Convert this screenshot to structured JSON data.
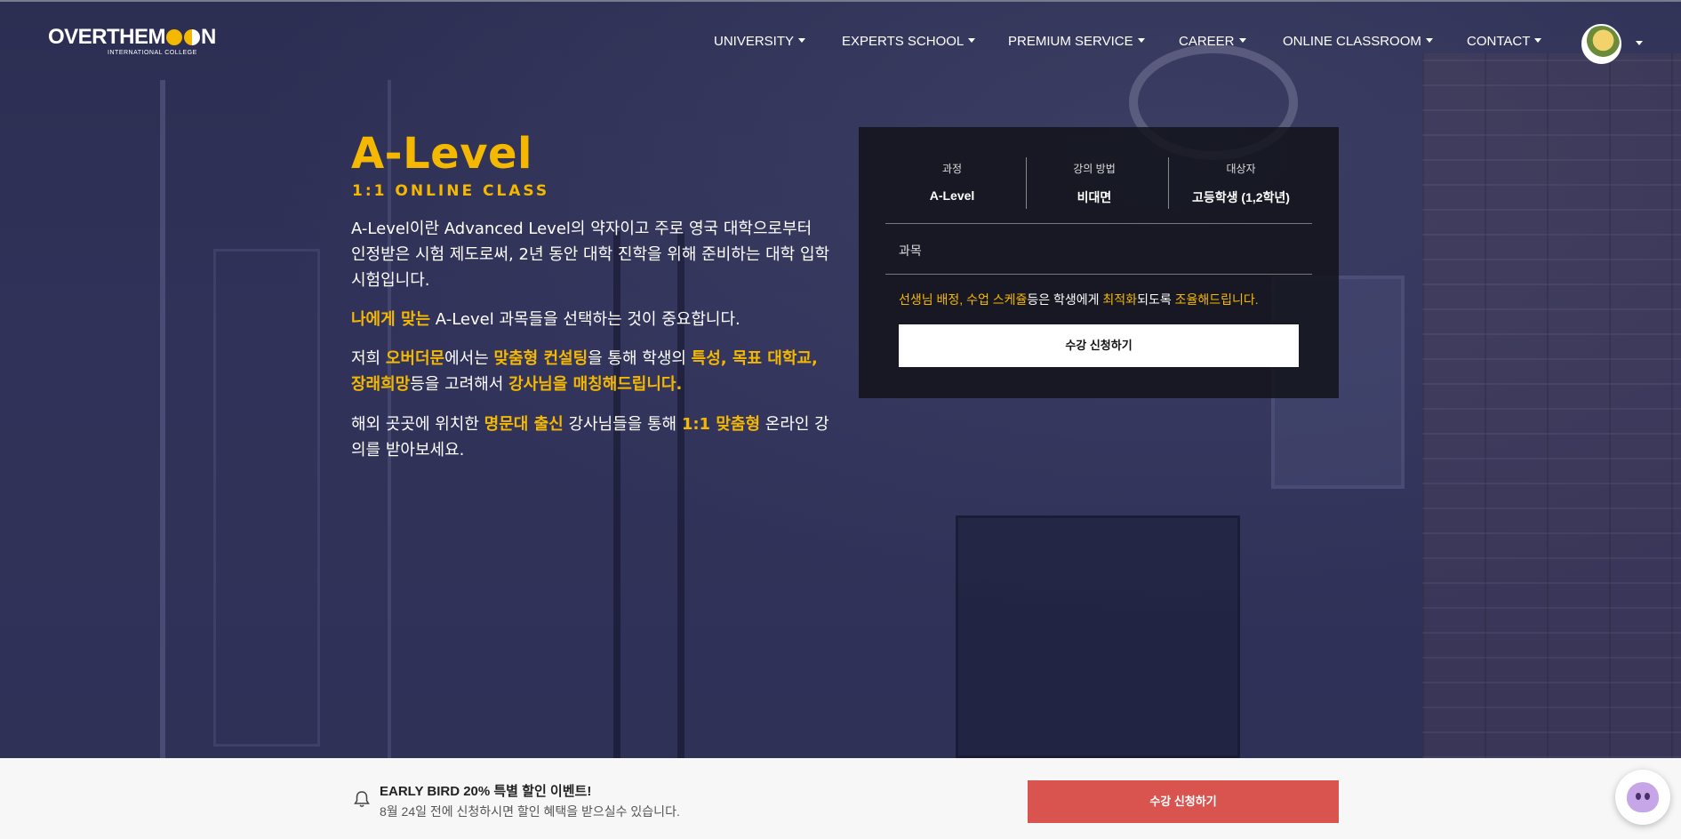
{
  "brand": {
    "logo_text_a": "OVERTHEM",
    "logo_text_b": "N",
    "logo_sub": "INTERNATIONAL COLLEGE"
  },
  "nav": {
    "items": [
      {
        "label": "UNIVERSITY"
      },
      {
        "label": "EXPERTS SCHOOL"
      },
      {
        "label": "PREMIUM SERVICE"
      },
      {
        "label": "CAREER"
      },
      {
        "label": "ONLINE CLASSROOM"
      },
      {
        "label": "CONTACT"
      }
    ]
  },
  "hero": {
    "title": "A-Level",
    "subtitle": "1:1 ONLINE CLASS",
    "p1": "A-Level이란 Advanced Level의 약자이고 주로 영국 대학으로부터 인정받은 시험 제도로써, 2년 동안 대학 진학을 위해 준비하는 대학 입학시험입니다.",
    "p2_hl": "나에게 맞는",
    "p2_rest": " A-Level 과목들을 선택하는 것이 중요합니다.",
    "p3_a": "저희 ",
    "p3_hl1": "오버더문",
    "p3_b": "에서는 ",
    "p3_hl2": "맞춤형 컨설팅",
    "p3_c": "을 통해 학생의 ",
    "p3_hl3": "특성, 목표 대학교, 장래희망",
    "p3_d": "등을 고려해서 ",
    "p3_hl4": "강사님을 매칭해드립니다.",
    "p4_a": "해외 곳곳에 위치한 ",
    "p4_hl1": "명문대 출신",
    "p4_b": " 강사님들을 통해 ",
    "p4_hl2": "1:1 맞춤형",
    "p4_c": " 온라인 강의를 받아보세요."
  },
  "course": {
    "col1_label": "과정",
    "col1_value": "A-Level",
    "col2_label": "강의 방법",
    "col2_value": "비대면",
    "col3_label": "대상자",
    "col3_value": "고등학생 (1,2학년)",
    "subject_label": "과목",
    "notice_hl1": "선생님 배정, 수업 스케쥴",
    "notice_a": "등은 학생에게 ",
    "notice_hl2": "최적화",
    "notice_b": "되도록 ",
    "notice_hl3": "조율해드립니다.",
    "apply_label": "수강 신청하기"
  },
  "early_bird": {
    "title": "EARLY BIRD 20% 특별 할인 이벤트!",
    "subtitle": "8월 24일 전에 신청하시면 할인 혜택을 받으실수 있습니다.",
    "button_label": "수강 신청하기"
  },
  "colors": {
    "accent": "#f5b800",
    "cta_red": "#d9534f",
    "panel": "#12131a"
  },
  "icons": {
    "bell": "bell-icon",
    "chat": "chat-bot-icon",
    "avatar": "user-avatar"
  }
}
